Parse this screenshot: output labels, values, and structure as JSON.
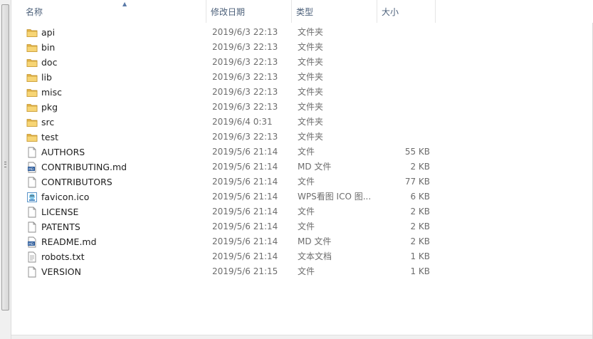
{
  "columns": {
    "name": "名称",
    "date": "修改日期",
    "type": "类型",
    "size": "大小"
  },
  "rows": [
    {
      "name": "api",
      "date": "2019/6/3 22:13",
      "type": "文件夹",
      "size": "",
      "icon": "folder-icon"
    },
    {
      "name": "bin",
      "date": "2019/6/3 22:13",
      "type": "文件夹",
      "size": "",
      "icon": "folder-icon"
    },
    {
      "name": "doc",
      "date": "2019/6/3 22:13",
      "type": "文件夹",
      "size": "",
      "icon": "folder-icon"
    },
    {
      "name": "lib",
      "date": "2019/6/3 22:13",
      "type": "文件夹",
      "size": "",
      "icon": "folder-icon"
    },
    {
      "name": "misc",
      "date": "2019/6/3 22:13",
      "type": "文件夹",
      "size": "",
      "icon": "folder-icon"
    },
    {
      "name": "pkg",
      "date": "2019/6/3 22:13",
      "type": "文件夹",
      "size": "",
      "icon": "folder-icon"
    },
    {
      "name": "src",
      "date": "2019/6/4 0:31",
      "type": "文件夹",
      "size": "",
      "icon": "folder-icon"
    },
    {
      "name": "test",
      "date": "2019/6/3 22:13",
      "type": "文件夹",
      "size": "",
      "icon": "folder-icon"
    },
    {
      "name": "AUTHORS",
      "date": "2019/5/6 21:14",
      "type": "文件",
      "size": "55 KB",
      "icon": "file-icon"
    },
    {
      "name": "CONTRIBUTING.md",
      "date": "2019/5/6 21:14",
      "type": "MD 文件",
      "size": "2 KB",
      "icon": "markdown-file-icon"
    },
    {
      "name": "CONTRIBUTORS",
      "date": "2019/5/6 21:14",
      "type": "文件",
      "size": "77 KB",
      "icon": "file-icon"
    },
    {
      "name": "favicon.ico",
      "date": "2019/5/6 21:14",
      "type": "WPS看图 ICO 图...",
      "size": "6 KB",
      "icon": "image-file-icon"
    },
    {
      "name": "LICENSE",
      "date": "2019/5/6 21:14",
      "type": "文件",
      "size": "2 KB",
      "icon": "file-icon"
    },
    {
      "name": "PATENTS",
      "date": "2019/5/6 21:14",
      "type": "文件",
      "size": "2 KB",
      "icon": "file-icon"
    },
    {
      "name": "README.md",
      "date": "2019/5/6 21:14",
      "type": "MD 文件",
      "size": "2 KB",
      "icon": "markdown-file-icon"
    },
    {
      "name": "robots.txt",
      "date": "2019/5/6 21:14",
      "type": "文本文档",
      "size": "1 KB",
      "icon": "text-file-icon"
    },
    {
      "name": "VERSION",
      "date": "2019/5/6 21:15",
      "type": "文件",
      "size": "1 KB",
      "icon": "file-icon"
    }
  ]
}
